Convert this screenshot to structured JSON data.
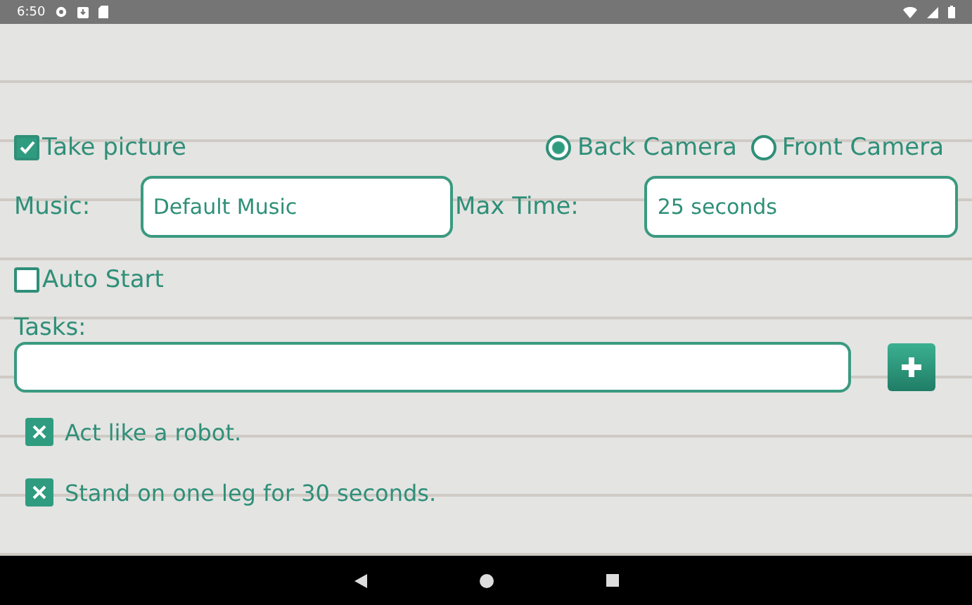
{
  "status_bar": {
    "time": "6:50"
  },
  "take_picture": {
    "label": "Take picture",
    "checked": true
  },
  "cameras": [
    {
      "label": "Back Camera",
      "selected": true
    },
    {
      "label": "Front Camera",
      "selected": false
    }
  ],
  "music": {
    "label": "Music:",
    "value": "Default Music"
  },
  "max_time": {
    "label": "Max Time:",
    "value": "25 seconds"
  },
  "auto_start": {
    "label": "Auto Start",
    "checked": false
  },
  "tasks": {
    "label": "Tasks:",
    "items": [
      {
        "text": "Act like a robot."
      },
      {
        "text": "Stand on one leg for 30 seconds."
      }
    ]
  }
}
